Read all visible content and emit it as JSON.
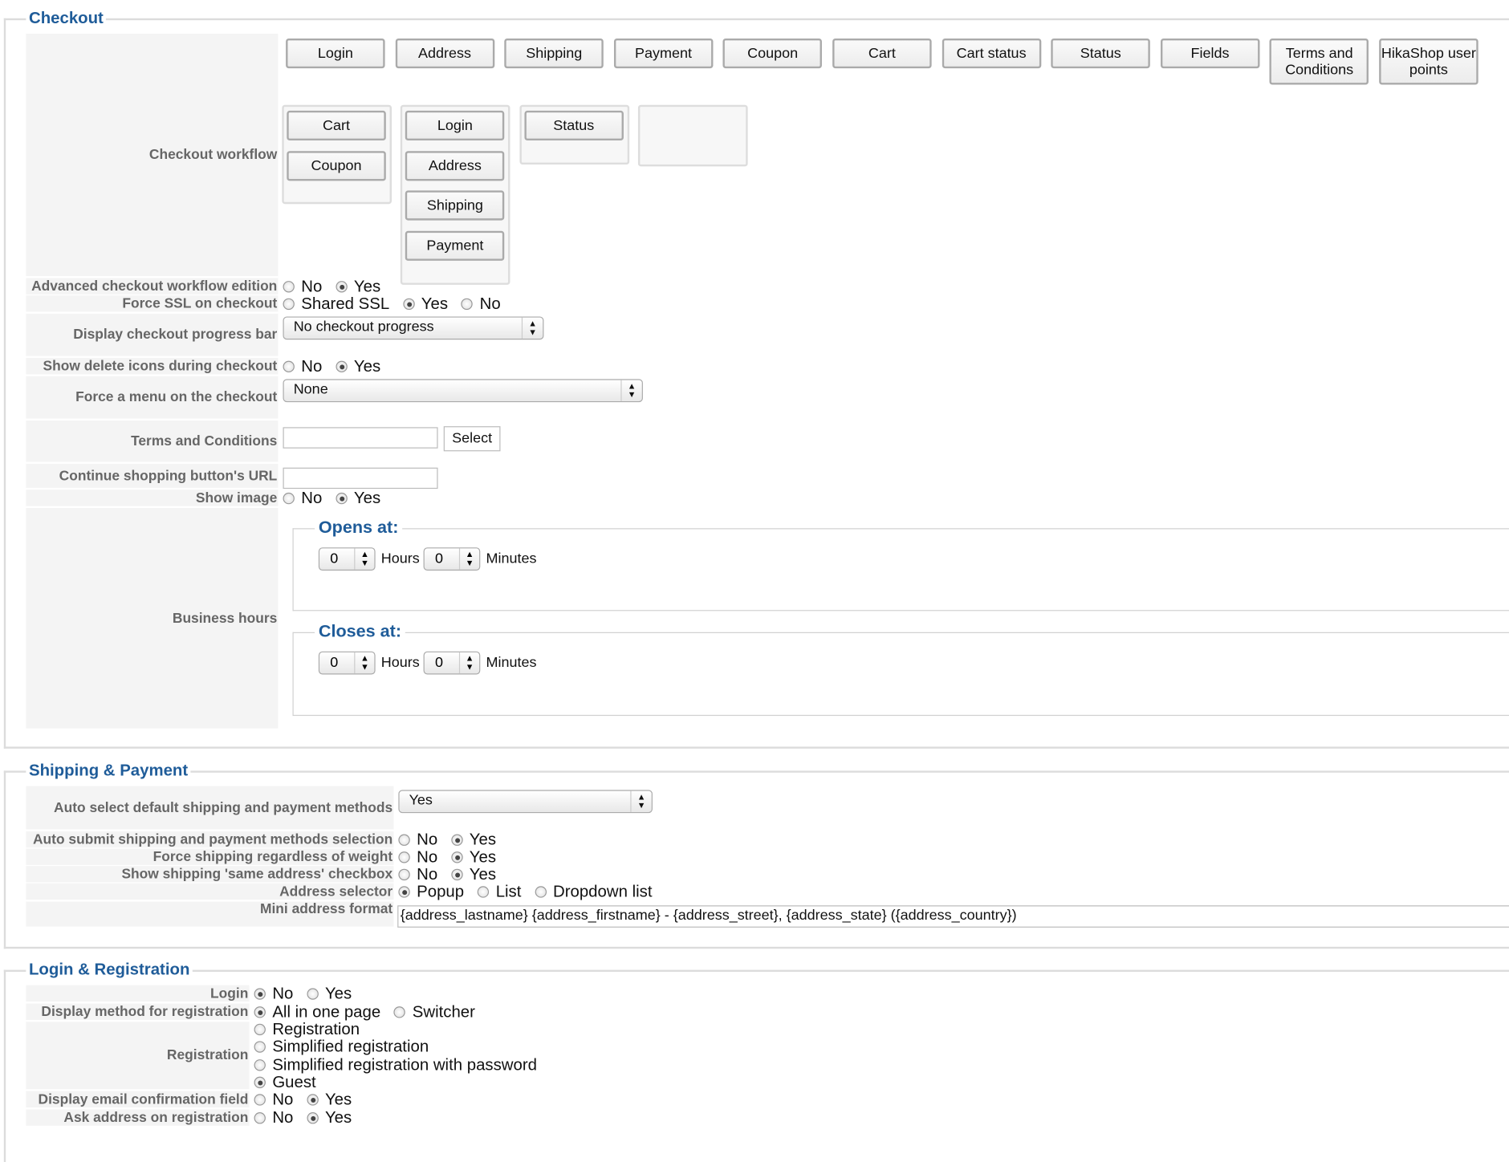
{
  "checkout": {
    "legend": "Checkout",
    "available_views": [
      "Login",
      "Address",
      "Shipping",
      "Payment",
      "Coupon",
      "Cart",
      "Cart status",
      "Status",
      "Fields",
      "Terms and Conditions",
      "HikaShop user points"
    ],
    "workflow_label": "Checkout workflow",
    "workflow_steps": [
      [
        "Cart",
        "Coupon"
      ],
      [
        "Login",
        "Address",
        "Shipping",
        "Payment"
      ],
      [
        "Status"
      ],
      []
    ],
    "advanced": {
      "label": "Advanced checkout workflow edition",
      "options": [
        "No",
        "Yes"
      ],
      "selected": "Yes"
    },
    "ssl": {
      "label": "Force SSL on checkout",
      "options": [
        "Shared SSL",
        "Yes",
        "No"
      ],
      "selected": "Yes"
    },
    "progress": {
      "label": "Display checkout progress bar",
      "value": "No checkout progress"
    },
    "delete_icons": {
      "label": "Show delete icons during checkout",
      "options": [
        "No",
        "Yes"
      ],
      "selected": "Yes"
    },
    "force_menu": {
      "label": "Force a menu on the checkout",
      "value": "None"
    },
    "terms": {
      "label": "Terms and Conditions",
      "value": "",
      "button": "Select"
    },
    "continue_url": {
      "label": "Continue shopping button's URL",
      "value": ""
    },
    "show_image": {
      "label": "Show image",
      "options": [
        "No",
        "Yes"
      ],
      "selected": "Yes"
    },
    "business_hours": {
      "label": "Business hours",
      "opens": {
        "legend": "Opens at:",
        "hours": "0",
        "hours_label": "Hours",
        "minutes": "0",
        "minutes_label": "Minutes"
      },
      "closes": {
        "legend": "Closes at:",
        "hours": "0",
        "hours_label": "Hours",
        "minutes": "0",
        "minutes_label": "Minutes"
      }
    }
  },
  "shipping": {
    "legend": "Shipping & Payment",
    "auto_select": {
      "label": "Auto select default shipping and payment methods",
      "value": "Yes"
    },
    "auto_submit": {
      "label": "Auto submit shipping and payment methods selection",
      "options": [
        "No",
        "Yes"
      ],
      "selected": "Yes"
    },
    "force_shipping": {
      "label": "Force shipping regardless of weight",
      "options": [
        "No",
        "Yes"
      ],
      "selected": "Yes"
    },
    "same_address": {
      "label": "Show shipping 'same address' checkbox",
      "options": [
        "No",
        "Yes"
      ],
      "selected": "Yes"
    },
    "address_selector": {
      "label": "Address selector",
      "options": [
        "Popup",
        "List",
        "Dropdown list"
      ],
      "selected": "Popup"
    },
    "mini_address": {
      "label": "Mini address format",
      "value": "{address_lastname} {address_firstname} - {address_street}, {address_state} ({address_country})"
    }
  },
  "login": {
    "legend": "Login & Registration",
    "login": {
      "label": "Login",
      "options": [
        "No",
        "Yes"
      ],
      "selected": "No"
    },
    "display_method": {
      "label": "Display method for registration",
      "options": [
        "All in one page",
        "Switcher"
      ],
      "selected": "All in one page"
    },
    "registration": {
      "label": "Registration",
      "options": [
        "Registration",
        "Simplified registration",
        "Simplified registration with password",
        "Guest"
      ],
      "selected": "Guest"
    },
    "email_confirm": {
      "label": "Display email confirmation field",
      "options": [
        "No",
        "Yes"
      ],
      "selected": "Yes"
    },
    "ask_address": {
      "label": "Ask address on registration",
      "options": [
        "No",
        "Yes"
      ],
      "selected": "Yes"
    }
  }
}
